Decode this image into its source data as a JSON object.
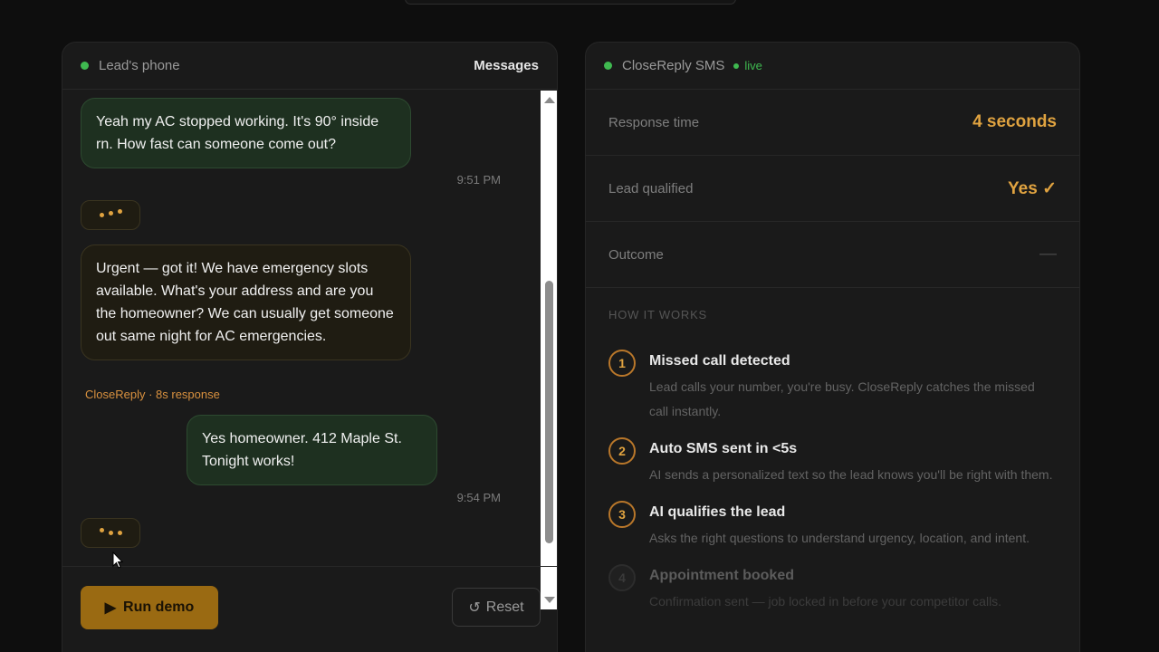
{
  "colors": {
    "accent": "#e0a340",
    "live": "#3fb950",
    "background": "#0e0e0e"
  },
  "left_panel": {
    "header": {
      "title": "Lead's phone",
      "right_label": "Messages"
    },
    "messages": [
      {
        "sender": "lead",
        "text": "Yeah my AC stopped working. It's 90° inside rn. How fast can someone come out?",
        "time": "9:51 PM"
      },
      {
        "sender": "ai",
        "text": "Urgent — got it! We have emergency slots available. What's your address and are you the homeowner? We can usually get someone out same night for AC emergencies.",
        "meta": "CloseReply · 8s response"
      },
      {
        "sender": "lead",
        "text": "Yes homeowner. 412 Maple St. Tonight works!",
        "time": "9:54 PM"
      }
    ],
    "run_button": {
      "icon": "play-icon",
      "glyph": "▶",
      "label": "Run demo"
    },
    "reset_button": {
      "icon": "reset-icon",
      "glyph": "↺",
      "label": "Reset"
    }
  },
  "right_panel": {
    "header": {
      "title": "CloseReply SMS",
      "status": "live"
    },
    "stats": [
      {
        "label": "Response time",
        "value": "4 seconds"
      },
      {
        "label": "Lead qualified",
        "value": "Yes ✓"
      },
      {
        "label": "Outcome",
        "value": "—"
      }
    ],
    "how_it_works": {
      "title": "HOW IT WORKS",
      "steps": [
        {
          "num": "1",
          "title": "Missed call detected",
          "desc": "Lead calls your number, you're busy. CloseReply catches the missed call instantly."
        },
        {
          "num": "2",
          "title": "Auto SMS sent in <5s",
          "desc": "AI sends a personalized text so the lead knows you'll be right with them."
        },
        {
          "num": "3",
          "title": "AI qualifies the lead",
          "desc": "Asks the right questions to understand urgency, location, and intent."
        },
        {
          "num": "4",
          "title": "Appointment booked",
          "desc": "Confirmation sent — job locked in before your competitor calls."
        }
      ]
    }
  }
}
